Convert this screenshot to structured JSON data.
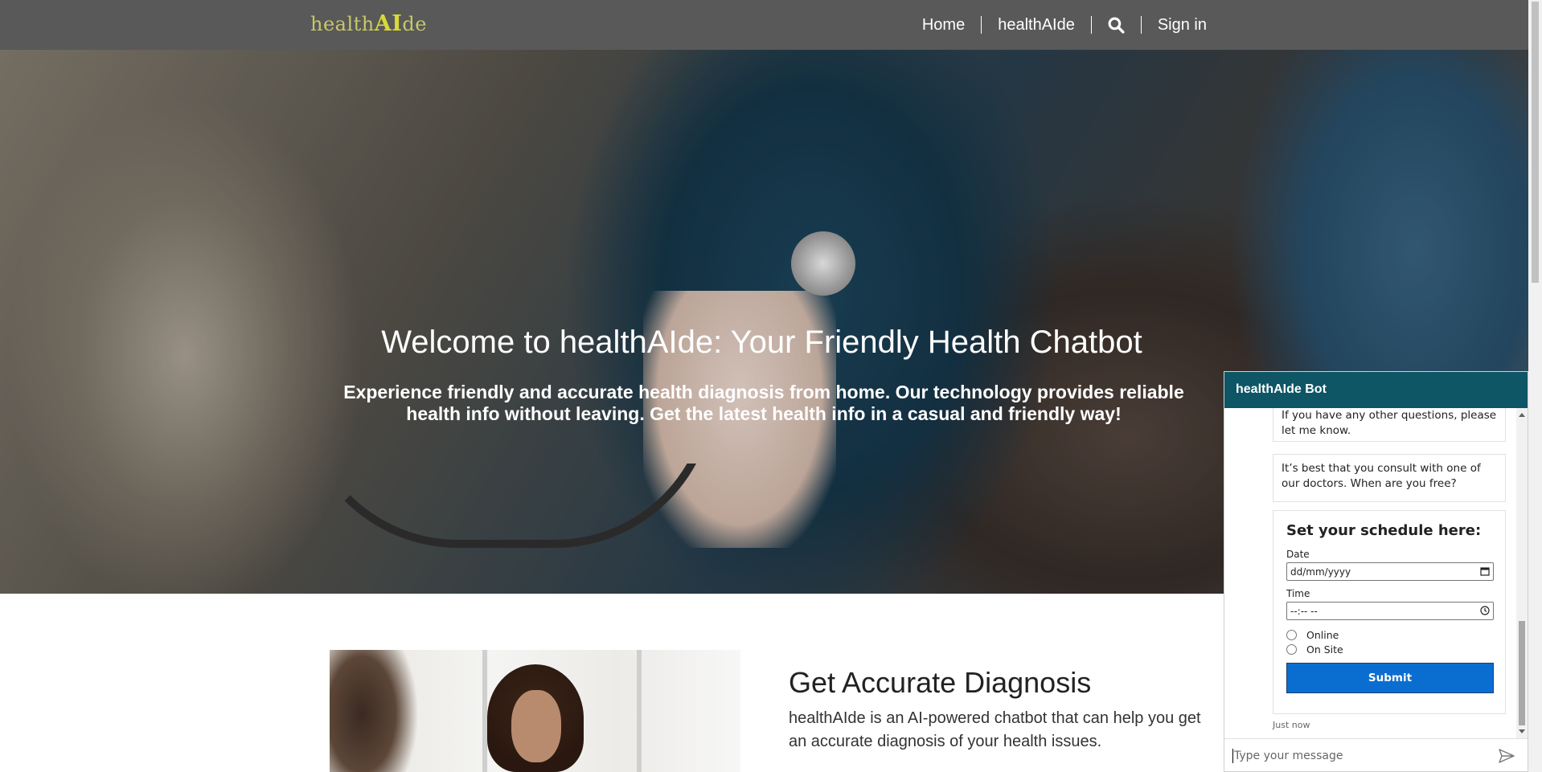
{
  "navbar": {
    "logo_part1": "health",
    "logo_part2": "AI",
    "logo_part3": "de",
    "links": [
      "Home",
      "healthAIde"
    ],
    "search_icon": "search-icon",
    "signin": "Sign in"
  },
  "hero": {
    "title": "Welcome to healthAIde: Your Friendly Health Chatbot",
    "subtitle": "Experience friendly and accurate health diagnosis from home. Our technology provides reliable health info without leaving. Get the latest health info in a casual and friendly way!"
  },
  "feature": {
    "title": "Get Accurate Diagnosis",
    "description": "healthAIde is an AI-powered chatbot that can help you get an accurate diagnosis of your health issues."
  },
  "chatbot": {
    "header": "healthAIde Bot",
    "messages": [
      "If you have any other questions, please let me know.",
      "It’s best that you consult with one of our doctors. When are you free?"
    ],
    "schedule_card": {
      "title": "Set your schedule here:",
      "date_label": "Date",
      "date_placeholder": "dd/mm/yyyy",
      "time_label": "Time",
      "time_placeholder": "--:-- --",
      "options": [
        "Online",
        "On Site"
      ],
      "submit": "Submit"
    },
    "timestamp": "Just now",
    "input_placeholder": "Type your message"
  },
  "colors": {
    "navbar_bg": "#595959",
    "logo": "#d8d83a",
    "chat_header_bg": "#0e5566",
    "submit_bg": "#0a6ed1"
  }
}
